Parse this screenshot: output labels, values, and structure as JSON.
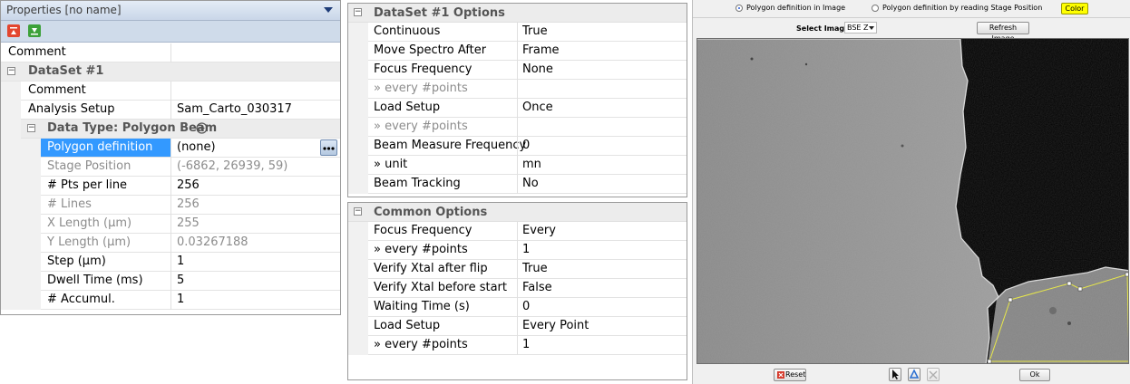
{
  "left": {
    "title": "Properties [no name]",
    "rows": {
      "comment_top": {
        "name": "Comment",
        "value": ""
      },
      "dataset": {
        "name": "DataSet #1"
      },
      "comment": {
        "name": "Comment",
        "value": ""
      },
      "analysis_setup": {
        "name": "Analysis Setup",
        "value": "Sam_Carto_030317"
      },
      "data_type": {
        "name": "Data Type: Polygon Beam",
        "icon": "add-circle-icon"
      },
      "polygon_def": {
        "name": "Polygon definition",
        "value": "(none)"
      },
      "stage_position": {
        "name": "Stage Position",
        "value": "(-6862, 26939, 59)"
      },
      "pts_per_line": {
        "name": "# Pts per line",
        "value": "256"
      },
      "lines": {
        "name": "# Lines",
        "value": "256"
      },
      "x_length": {
        "name": "X Length (µm)",
        "value": "255"
      },
      "y_length": {
        "name": "Y Length (µm)",
        "value": "0.03267188"
      },
      "step": {
        "name": "Step (µm)",
        "value": "1"
      },
      "dwell": {
        "name": "Dwell Time (ms)",
        "value": "5"
      },
      "accumul": {
        "name": "# Accumul.",
        "value": "1"
      }
    }
  },
  "dataset_options": {
    "title": "DataSet #1 Options",
    "rows": [
      {
        "name": "Continuous",
        "value": "True",
        "grey": false
      },
      {
        "name": "Move Spectro After",
        "value": "Frame",
        "grey": false
      },
      {
        "name": "Focus Frequency",
        "value": "None",
        "grey": false
      },
      {
        "name": "» every #points",
        "value": "",
        "grey": true
      },
      {
        "name": "Load Setup",
        "value": "Once",
        "grey": false
      },
      {
        "name": "» every #points",
        "value": "",
        "grey": true
      },
      {
        "name": "Beam Measure Frequency",
        "value": "0",
        "grey": false
      },
      {
        "name": "» unit",
        "value": "mn",
        "grey": false
      },
      {
        "name": "Beam Tracking",
        "value": "No",
        "grey": false
      }
    ]
  },
  "common_options": {
    "title": "Common Options",
    "rows": [
      {
        "name": "Focus Frequency",
        "value": "Every",
        "grey": false
      },
      {
        "name": "» every #points",
        "value": "1",
        "grey": false
      },
      {
        "name": "Verify Xtal after flip",
        "value": "True",
        "grey": false
      },
      {
        "name": "Verify Xtal before start",
        "value": "False",
        "grey": false
      },
      {
        "name": "Waiting Time (s)",
        "value": "0",
        "grey": false
      },
      {
        "name": "Load Setup",
        "value": "Every Point",
        "grey": false
      },
      {
        "name": "» every #points",
        "value": "1",
        "grey": false
      }
    ]
  },
  "image_panel": {
    "radio_image": "Polygon definition in Image",
    "radio_stage": "Polygon definition by reading Stage Position",
    "color_button": "Color",
    "select_label": "Select Image",
    "select_value": "BSE Z",
    "refresh_button": "Refresh Image",
    "reset_button": "Reset",
    "ok_button": "Ok"
  },
  "colors": {
    "selection": "#3399ff",
    "color_button": "#ffff00",
    "polygon": "#e8e84a"
  }
}
